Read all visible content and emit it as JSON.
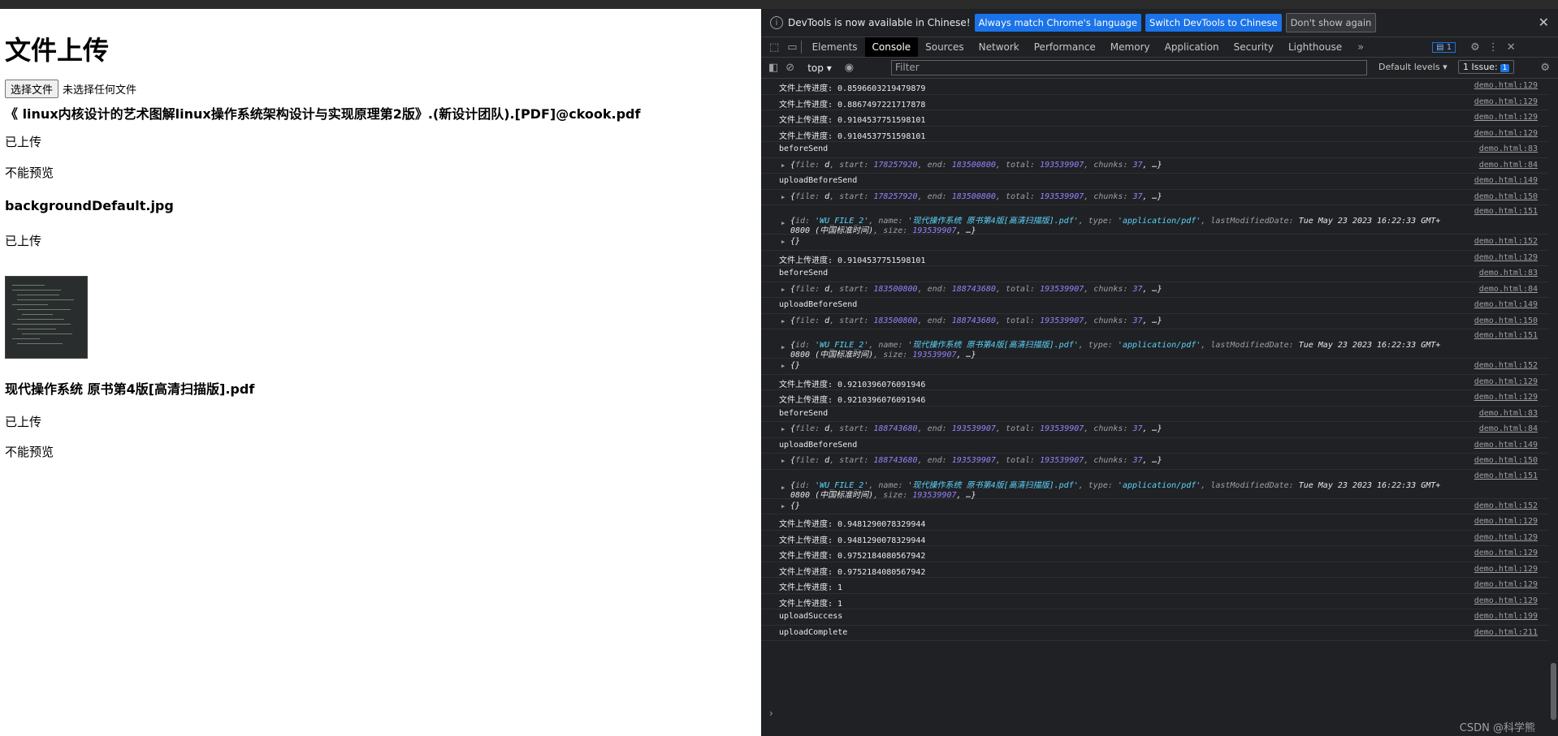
{
  "page": {
    "title": "文件上传",
    "choose_button": "选择文件",
    "no_file_text": "未选择任何文件",
    "file1_name": "《 linux内核设计的艺术图解linux操作系统架构设计与实现原理第2版》.(新设计团队).[PDF]@ckook.pdf",
    "file1_status": "已上传",
    "file1_preview": "不能预览",
    "file2_name": "backgroundDefault.jpg",
    "file2_status": "已上传",
    "file3_name": "现代操作系统 原书第4版[高清扫描版].pdf",
    "file3_status": "已上传",
    "file3_preview": "不能预览"
  },
  "devtools": {
    "infobar": {
      "text": "DevTools is now available in Chinese!",
      "btn_match": "Always match Chrome's language",
      "btn_switch": "Switch DevTools to Chinese",
      "btn_dismiss": "Don't show again"
    },
    "tabs": [
      "Elements",
      "Console",
      "Sources",
      "Network",
      "Performance",
      "Memory",
      "Application",
      "Security",
      "Lighthouse"
    ],
    "active_tab": "Console",
    "msg_badge": "1",
    "context": "top",
    "filter_placeholder": "Filter",
    "levels": "Default levels",
    "issues_label": "1 Issue:",
    "issues_badge": "1",
    "watermark": "CSDN @科学熊"
  },
  "console_rows": [
    {
      "type": "plain",
      "text": "文件上传进度: 0.8596603219479879",
      "src": "demo.html:129"
    },
    {
      "type": "plain",
      "text": "文件上传进度: 0.8867497221717878",
      "src": "demo.html:129"
    },
    {
      "type": "plain",
      "text": "文件上传进度: 0.9104537751598101",
      "src": "demo.html:129"
    },
    {
      "type": "plain",
      "text": "文件上传进度: 0.9104537751598101",
      "src": "demo.html:129"
    },
    {
      "type": "plain",
      "text": "beforeSend",
      "src": "demo.html:83"
    },
    {
      "type": "chunk",
      "start": "178257920",
      "end": "183500800",
      "total": "193539907",
      "chunks": "37",
      "src": "demo.html:84"
    },
    {
      "type": "plain",
      "text": "uploadBeforeSend",
      "src": "demo.html:149"
    },
    {
      "type": "chunk",
      "start": "178257920",
      "end": "183500800",
      "total": "193539907",
      "chunks": "37",
      "src": "demo.html:150"
    },
    {
      "type": "fileobj",
      "id": "'WU_FILE_2'",
      "name": "'现代操作系统  原书第4版[高清扫描版].pdf'",
      "mime": "'application/pdf'",
      "date": "Tue May 23 2023 16:22:33 GMT+",
      "date2": "0800 (中国标准时间)",
      "size": "193539907",
      "src": "demo.html:151"
    },
    {
      "type": "empty",
      "text": "{}",
      "src": "demo.html:152"
    },
    {
      "type": "plain",
      "text": "文件上传进度: 0.9104537751598101",
      "src": "demo.html:129"
    },
    {
      "type": "plain",
      "text": "beforeSend",
      "src": "demo.html:83"
    },
    {
      "type": "chunk",
      "start": "183500800",
      "end": "188743680",
      "total": "193539907",
      "chunks": "37",
      "src": "demo.html:84"
    },
    {
      "type": "plain",
      "text": "uploadBeforeSend",
      "src": "demo.html:149"
    },
    {
      "type": "chunk",
      "start": "183500800",
      "end": "188743680",
      "total": "193539907",
      "chunks": "37",
      "src": "demo.html:150"
    },
    {
      "type": "fileobj",
      "id": "'WU_FILE_2'",
      "name": "'现代操作系统  原书第4版[高清扫描版].pdf'",
      "mime": "'application/pdf'",
      "date": "Tue May 23 2023 16:22:33 GMT+",
      "date2": "0800 (中国标准时间)",
      "size": "193539907",
      "src": "demo.html:151"
    },
    {
      "type": "empty",
      "text": "{}",
      "src": "demo.html:152"
    },
    {
      "type": "plain",
      "text": "文件上传进度: 0.9210396076091946",
      "src": "demo.html:129"
    },
    {
      "type": "plain",
      "text": "文件上传进度: 0.9210396076091946",
      "src": "demo.html:129"
    },
    {
      "type": "plain",
      "text": "beforeSend",
      "src": "demo.html:83"
    },
    {
      "type": "chunk",
      "start": "188743680",
      "end": "193539907",
      "total": "193539907",
      "chunks": "37",
      "src": "demo.html:84"
    },
    {
      "type": "plain",
      "text": "uploadBeforeSend",
      "src": "demo.html:149"
    },
    {
      "type": "chunk",
      "start": "188743680",
      "end": "193539907",
      "total": "193539907",
      "chunks": "37",
      "src": "demo.html:150"
    },
    {
      "type": "fileobj",
      "id": "'WU_FILE_2'",
      "name": "'现代操作系统  原书第4版[高清扫描版].pdf'",
      "mime": "'application/pdf'",
      "date": "Tue May 23 2023 16:22:33 GMT+",
      "date2": "0800 (中国标准时间)",
      "size": "193539907",
      "src": "demo.html:151"
    },
    {
      "type": "empty",
      "text": "{}",
      "src": "demo.html:152"
    },
    {
      "type": "plain",
      "text": "文件上传进度: 0.9481290078329944",
      "src": "demo.html:129"
    },
    {
      "type": "plain",
      "text": "文件上传进度: 0.9481290078329944",
      "src": "demo.html:129"
    },
    {
      "type": "plain",
      "text": "文件上传进度: 0.9752184080567942",
      "src": "demo.html:129"
    },
    {
      "type": "plain",
      "text": "文件上传进度: 0.9752184080567942",
      "src": "demo.html:129"
    },
    {
      "type": "plain",
      "text": "文件上传进度: 1",
      "src": "demo.html:129"
    },
    {
      "type": "plain",
      "text": "文件上传进度: 1",
      "src": "demo.html:129"
    },
    {
      "type": "plain",
      "text": "uploadSuccess",
      "src": "demo.html:199"
    },
    {
      "type": "plain",
      "text": "uploadComplete",
      "src": "demo.html:211"
    }
  ]
}
